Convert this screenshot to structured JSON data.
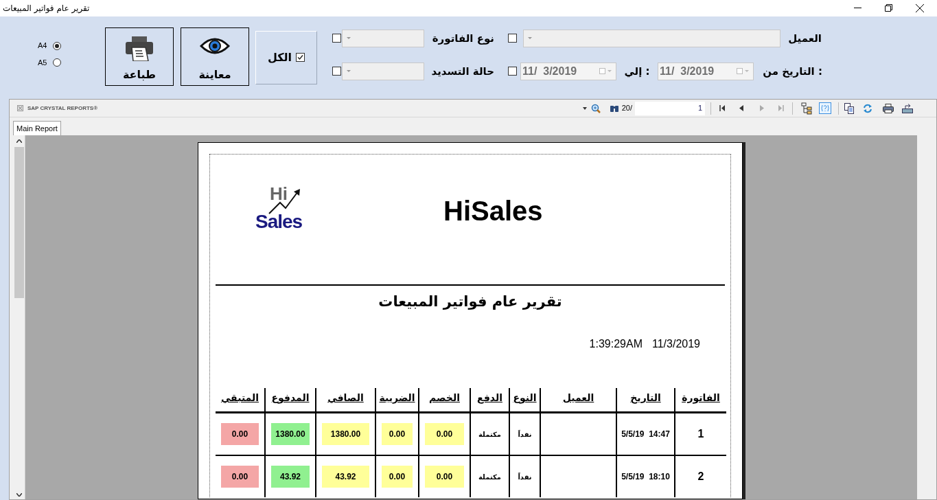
{
  "window": {
    "title": "تقرير عام فواتير المبيعات"
  },
  "paper_sizes": [
    {
      "label": "A4",
      "selected": true
    },
    {
      "label": "A5",
      "selected": false
    }
  ],
  "buttons": [
    {
      "label": "معاينة",
      "kind": "preview"
    },
    {
      "label": "طباعة",
      "kind": "print"
    }
  ],
  "all_checkbox": {
    "label": "الكل",
    "checked": true
  },
  "filters": {
    "customer": {
      "label": "العميل",
      "checked": false
    },
    "invoice_type": {
      "label": "نوع الفاتورة",
      "checked": false
    },
    "payment_status": {
      "label": "حالة التسديد",
      "checked": false
    },
    "date_from": {
      "label": "التاريخ من :",
      "value": "11/  3/2019"
    },
    "date_to": {
      "label": "إلي :",
      "value": "11/  3/2019"
    },
    "date_checked": false
  },
  "viewer": {
    "brand": "SAP CRYSTAL REPORTS®",
    "page_total": "20/",
    "page": "1",
    "tab": "Main Report"
  },
  "report": {
    "logo": {
      "top": "Hi",
      "bottom": "Sales"
    },
    "brand": "HiSales",
    "title": "تقرير عام فواتير المبيعات",
    "time": "1:39:29AM",
    "date": "11/3/2019",
    "columns": [
      {
        "label": "الفاتورة"
      },
      {
        "label": "التاريخ"
      },
      {
        "label": "العميل"
      },
      {
        "label": "النوع"
      },
      {
        "label": "الدفع"
      },
      {
        "label": "الخصم",
        "color": "#ffff99"
      },
      {
        "label": "الضريبة",
        "color": "#ffff99"
      },
      {
        "label": "الصافي",
        "color": "#ffff99"
      },
      {
        "label": "المدفوع",
        "color": "#90f090"
      },
      {
        "label": "المتبقي",
        "color": "#f4a6a6"
      }
    ],
    "rows": [
      {
        "invoice": "1",
        "date": "5/5/19  14:47",
        "type": "نقداً",
        "payment": "مكتملة",
        "discount": "0.00",
        "tax": "0.00",
        "net": "1380.00",
        "paid": "1380.00",
        "remaining": "0.00"
      },
      {
        "invoice": "2",
        "date": "5/5/19  18:10",
        "type": "نقداً",
        "payment": "مكتملة",
        "discount": "0.00",
        "tax": "0.00",
        "net": "43.92",
        "paid": "43.92",
        "remaining": "0.00"
      }
    ]
  }
}
